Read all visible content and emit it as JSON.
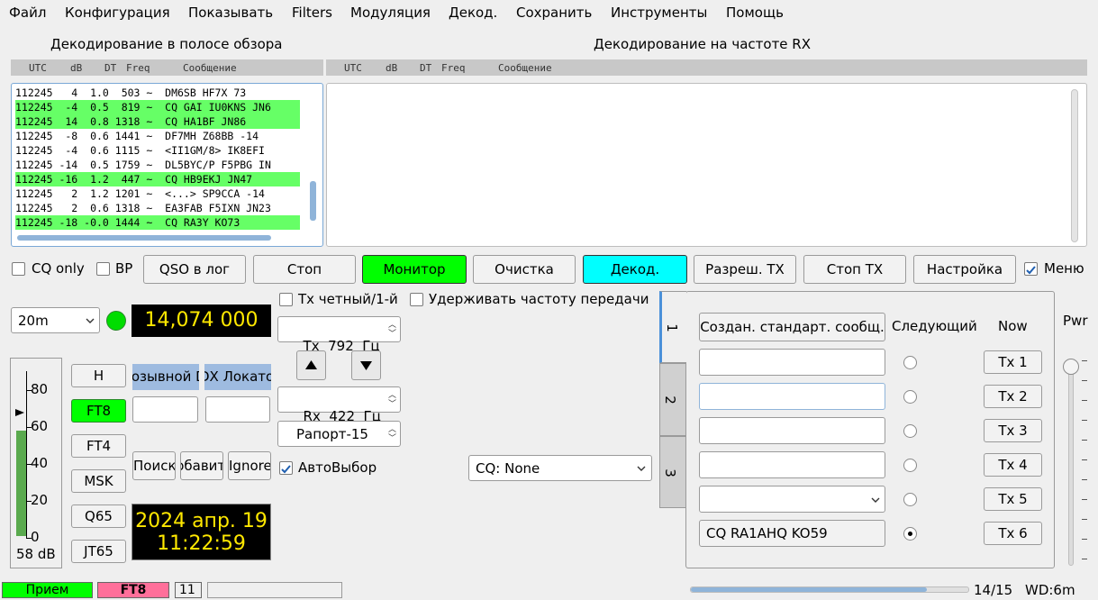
{
  "menu": [
    "Файл",
    "Конфигурация",
    "Показывать",
    "Filters",
    "Модуляция",
    "Декод.",
    "Сохранить",
    "Инструменты",
    "Помощь"
  ],
  "band_panel": {
    "title": "Декодирование в полосе обзора",
    "columns": [
      "UTC",
      "dB",
      "DT",
      "Freq",
      "Сообщение"
    ],
    "rows": [
      {
        "text": "112245   4  1.0  503 ~  DM6SB HF7X 73",
        "cq": false
      },
      {
        "text": "112245  -4  0.5  819 ~  CQ GAI IU0KNS JN6",
        "cq": true
      },
      {
        "text": "112245  14  0.8 1318 ~  CQ HA1BF JN86",
        "cq": true
      },
      {
        "text": "112245  -8  0.6 1441 ~  DF7MH Z68BB -14",
        "cq": false
      },
      {
        "text": "112245  -4  0.6 1115 ~  <II1GM/8> IK8EFI",
        "cq": false
      },
      {
        "text": "112245 -14  0.5 1759 ~  DL5BYC/P F5PBG IN",
        "cq": false
      },
      {
        "text": "112245 -16  1.2  447 ~  CQ HB9EKJ JN47",
        "cq": true
      },
      {
        "text": "112245   2  1.2 1201 ~  <...> SP9CCA -14",
        "cq": false
      },
      {
        "text": "112245   2  0.6 1318 ~  EA3FAB F5IXN JN23",
        "cq": false
      },
      {
        "text": "112245 -18 -0.0 1444 ~  CQ RA3Y KO73",
        "cq": true
      }
    ]
  },
  "rx_panel": {
    "title": "Декодирование на частоте RX",
    "columns": [
      "UTC",
      "dB",
      "DT",
      "Freq",
      "Сообщение"
    ]
  },
  "controls": {
    "cq_only": "CQ only",
    "bp": "BP",
    "log_qso": "QSO в лог",
    "stop": "Стоп",
    "monitor": "Монитор",
    "clear": "Очистка",
    "decode": "Декод.",
    "enable_tx": "Разреш. TX",
    "stop_tx": "Стоп TX",
    "settings": "Настройка",
    "menu": "Меню"
  },
  "left": {
    "band": "20m",
    "frequency": "14,074 000",
    "modes": [
      "H",
      "FT8",
      "FT4",
      "MSK",
      "Q65",
      "JT65"
    ],
    "dx_call_label": "Позывной DX",
    "dx_grid_label": "DX Локатор",
    "lookup": "Поиск",
    "add": "Добавить",
    "ignore": "Ignore",
    "date": "2024 апр. 19",
    "time": "11:22:59",
    "meter_ticks": [
      "80",
      "60",
      "40",
      "20",
      "0"
    ],
    "meter_db": "58 dB",
    "meter_level": 0.58
  },
  "mid": {
    "tx_even": "Tx четный/1-й",
    "hold_tx": "Удерживать частоту передачи",
    "tx_freq": "Tx  792  Гц",
    "rx_freq": "Rx  422  Гц",
    "report": "Рапорт-15",
    "auto_seq": "АвтоВыбор",
    "cq_select": "CQ: None"
  },
  "tx_panel": {
    "tabs": [
      "1",
      "2",
      "3"
    ],
    "gen_std": "Создан. стандарт. сообщ.",
    "next": "Следующий",
    "now": "Now",
    "tx_buttons": [
      "Tx 1",
      "Tx 2",
      "Tx 3",
      "Tx 4",
      "Tx 5",
      "Tx 6"
    ],
    "tx6_msg": "CQ RA1AHQ KO59",
    "selected": 6
  },
  "pwr_label": "Pwr",
  "status": {
    "receiving": "Прием",
    "mode": "FT8",
    "count": "11",
    "progress": 0.85,
    "period": "14/15",
    "wd": "WD:6m"
  }
}
